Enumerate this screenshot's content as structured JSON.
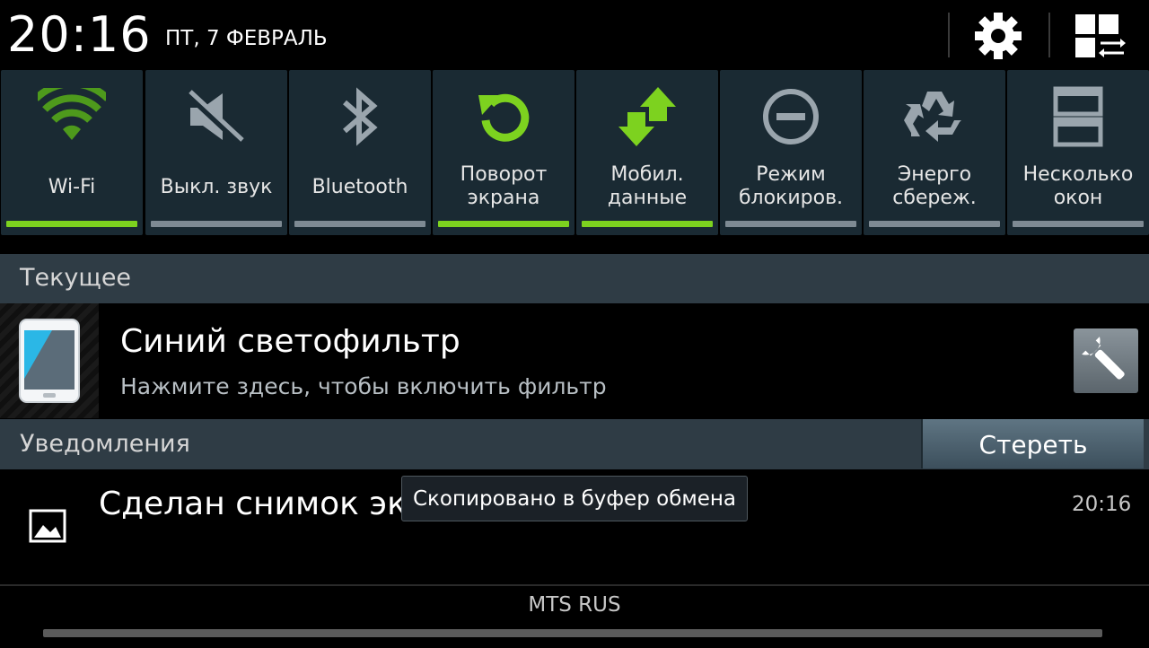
{
  "status": {
    "time": "20:16",
    "date": "ПТ, 7 ФЕВРАЛЬ"
  },
  "toggles": [
    {
      "label": "Wi-Fi",
      "icon": "wifi-icon",
      "on": true
    },
    {
      "label": "Выкл. звук",
      "icon": "mute-icon",
      "on": false
    },
    {
      "label": "Bluetooth",
      "icon": "bluetooth-icon",
      "on": false
    },
    {
      "label": "Поворот экрана",
      "label_l1": "Поворот",
      "label_l2": "экрана",
      "icon": "rotate-icon",
      "on": true
    },
    {
      "label": "Мобил. данные",
      "label_l1": "Мобил.",
      "label_l2": "данные",
      "icon": "mobile-data-icon",
      "on": true
    },
    {
      "label": "Режим блокиров.",
      "label_l1": "Режим",
      "label_l2": "блокиров.",
      "icon": "block-mode-icon",
      "on": false
    },
    {
      "label": "Энерго сбереж.",
      "label_l1": "Энерго",
      "label_l2": "сбереж.",
      "icon": "power-saving-icon",
      "on": false
    },
    {
      "label": "Несколько окон",
      "label_l1": "Несколько",
      "label_l2": "окон",
      "icon": "multi-window-icon",
      "on": false
    }
  ],
  "ongoing": {
    "header": "Текущее",
    "title": "Синий светофильтр",
    "subtitle": "Нажмите здесь, чтобы включить фильтр"
  },
  "notifications": {
    "header": "Уведомления",
    "clear_label": "Стереть",
    "items": [
      {
        "title": "Сделан снимок экра",
        "time": "20:16"
      }
    ]
  },
  "toast": "Скопировано в буфер обмена",
  "carrier": "MTS RUS",
  "colors": {
    "accent_on": "#7dd21f",
    "off_bar": "#7e8a93",
    "tile_bg": "#1a2a33",
    "section_bg": "#2f3c45"
  }
}
